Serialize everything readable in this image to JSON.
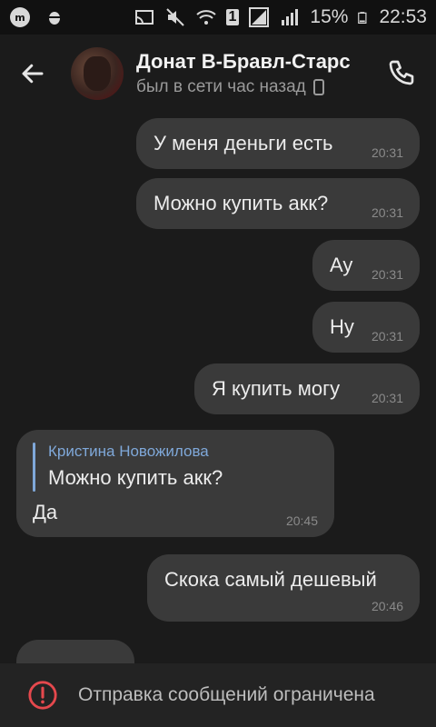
{
  "status_bar": {
    "app_icons": [
      "m-app-icon",
      "bug-icon"
    ],
    "battery_percent": "15%",
    "time": "22:53",
    "sim_slot": "1"
  },
  "header": {
    "title": "Донат В-Бравл-Старс",
    "subtitle": "был в сети час назад",
    "back_icon": "arrow-left-icon",
    "call_icon": "phone-icon"
  },
  "messages": [
    {
      "text": "У меня деньги есть",
      "time": "20:31",
      "direction": "out"
    },
    {
      "text": "Можно купить акк?",
      "time": "20:31",
      "direction": "out"
    },
    {
      "text": "Ау",
      "time": "20:31",
      "direction": "out"
    },
    {
      "text": "Ну",
      "time": "20:31",
      "direction": "out"
    },
    {
      "text": "Я купить могу",
      "time": "20:31",
      "direction": "out"
    },
    {
      "reply_author": "Кристина Новожилова",
      "reply_text": "Можно купить акк?",
      "text": "Да",
      "time": "20:45",
      "direction": "in"
    },
    {
      "text": "Скока самый дешевый",
      "time": "20:46",
      "direction": "out"
    }
  ],
  "footer": {
    "text": "Отправка сообщений ограничена",
    "icon": "alert-circle-icon",
    "accent": "#e5484d"
  }
}
